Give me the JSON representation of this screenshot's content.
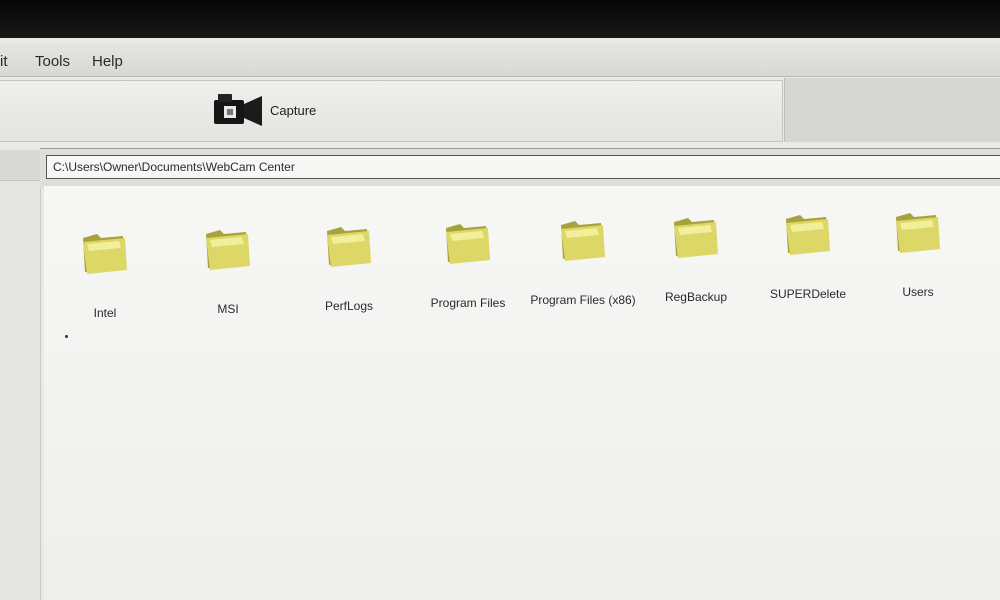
{
  "menu": {
    "items": [
      {
        "label": "it"
      },
      {
        "label": "Tools"
      },
      {
        "label": "Help"
      }
    ]
  },
  "toolbar": {
    "capture_label": "Capture",
    "capture_icon": "video-camera-icon"
  },
  "address": {
    "path": "C:\\Users\\Owner\\Documents\\WebCam Center"
  },
  "folders": [
    {
      "label": "Intel"
    },
    {
      "label": "MSI"
    },
    {
      "label": "PerfLogs"
    },
    {
      "label": "Program Files"
    },
    {
      "label": "Program Files (x86)"
    },
    {
      "label": "RegBackup"
    },
    {
      "label": "SUPERDelete"
    },
    {
      "label": "Users"
    }
  ],
  "colors": {
    "folder_fill": "#dcd766",
    "folder_shade": "#a8a23c",
    "folder_highlight": "#f2ef9a"
  }
}
